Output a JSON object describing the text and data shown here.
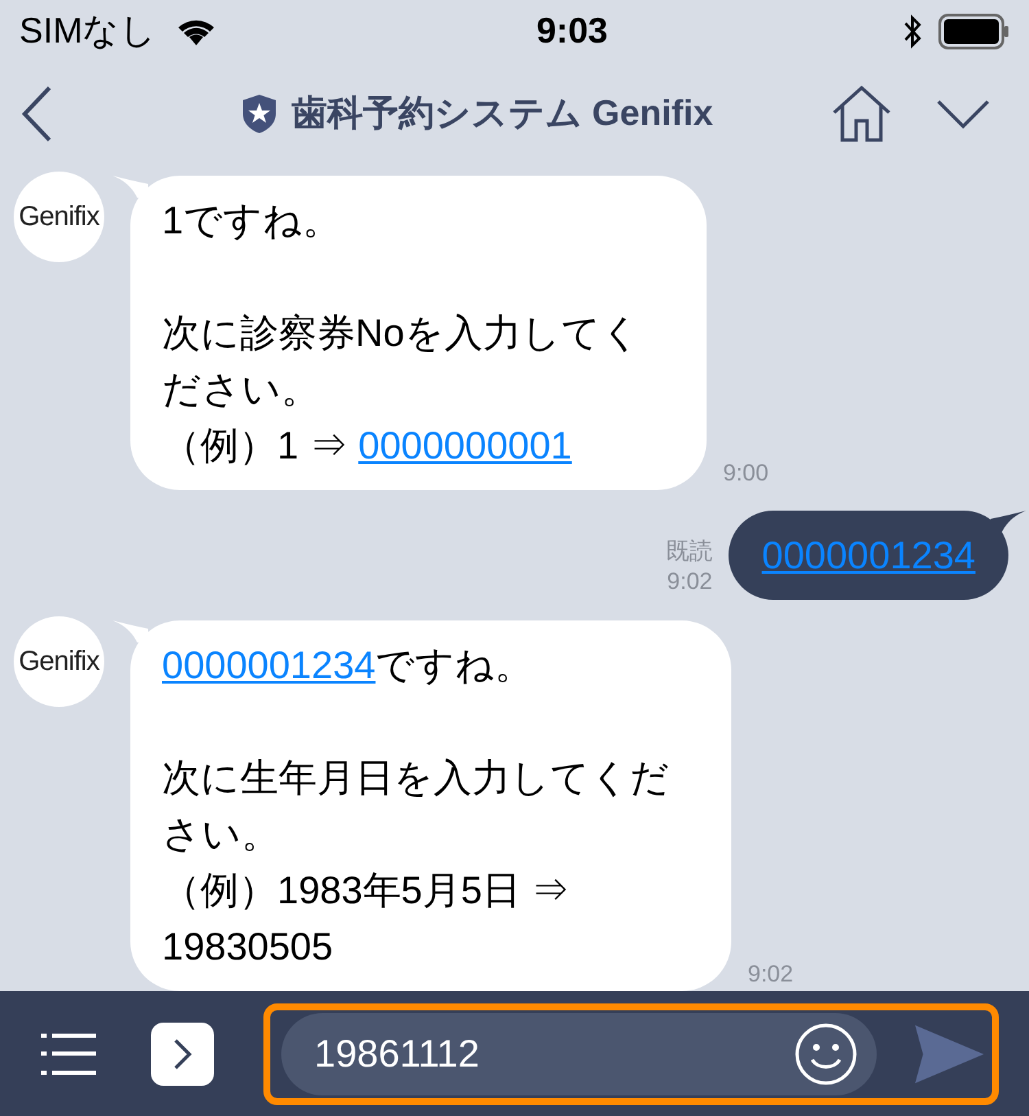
{
  "status_bar": {
    "carrier": "SIMなし",
    "time": "9:03"
  },
  "header": {
    "title": "歯科予約システム Genifix"
  },
  "messages": [
    {
      "kind": "incoming",
      "avatar": "Genifix",
      "time": "9:00",
      "sections": [
        [
          [
            {
              "kind": "text",
              "text": "1ですね。"
            }
          ]
        ],
        [
          [
            {
              "kind": "text",
              "text": "次に診察券Noを入力してください。"
            }
          ],
          [
            {
              "kind": "text",
              "text": "（例）1 ⇒ "
            },
            {
              "kind": "link",
              "text": "0000000001"
            }
          ]
        ]
      ]
    },
    {
      "kind": "outgoing",
      "read": "既読",
      "time": "9:02",
      "sections": [
        [
          [
            {
              "kind": "link",
              "text": "0000001234"
            }
          ]
        ]
      ]
    },
    {
      "kind": "incoming",
      "avatar": "Genifix",
      "time": "9:02",
      "sections": [
        [
          [
            {
              "kind": "link",
              "text": "0000001234"
            },
            {
              "kind": "text",
              "text": "ですね。"
            }
          ]
        ],
        [
          [
            {
              "kind": "text",
              "text": "次に生年月日を入力してください。"
            }
          ],
          [
            {
              "kind": "text",
              "text": "（例）1983年5月5日 ⇒ 19830505"
            }
          ]
        ]
      ]
    }
  ],
  "input": {
    "value": "19861112",
    "highlighted": true
  }
}
